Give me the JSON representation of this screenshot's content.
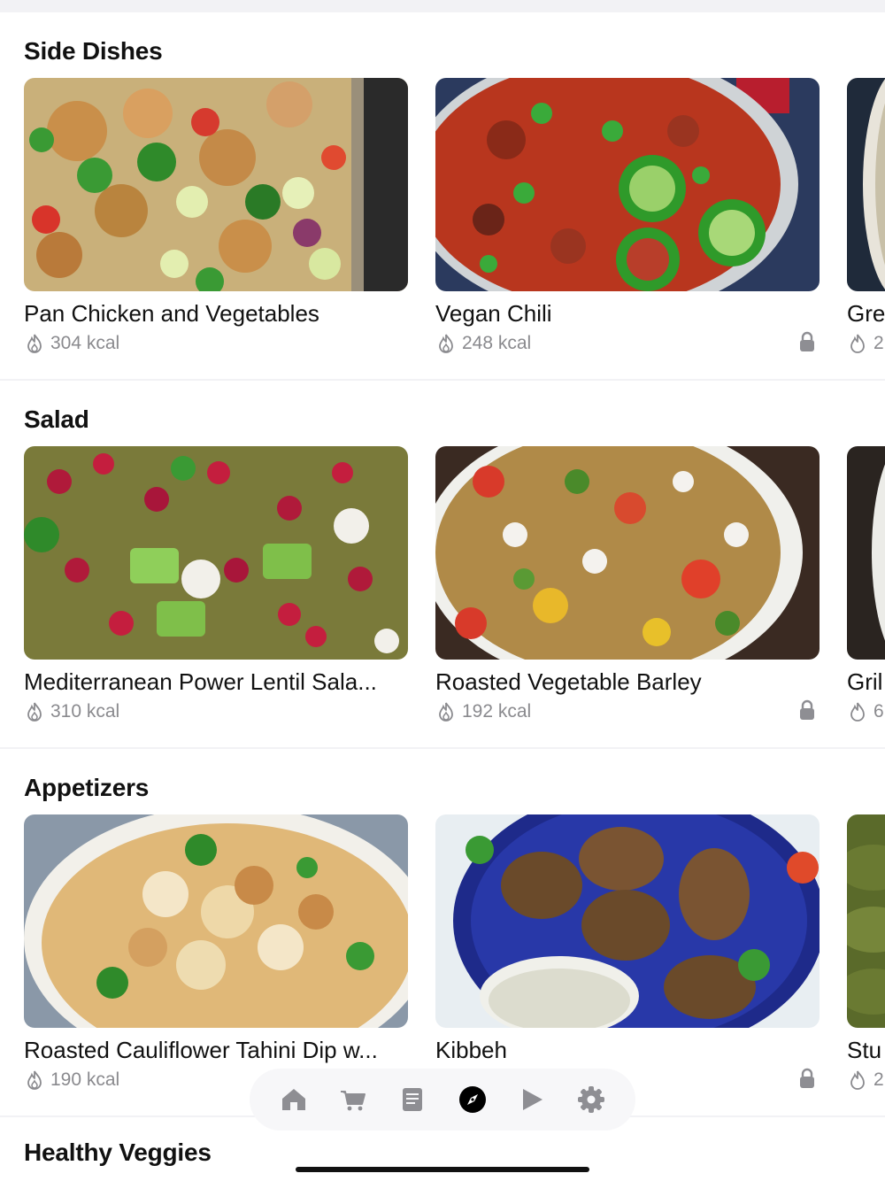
{
  "sections": [
    {
      "title": "Side Dishes",
      "cards": [
        {
          "name": "Pan Chicken and Vegetables",
          "kcal": "304 kcal",
          "locked": false
        },
        {
          "name": "Vegan Chili",
          "kcal": "248 kcal",
          "locked": true
        },
        {
          "name": "Gre",
          "kcal": "2",
          "locked": false
        }
      ]
    },
    {
      "title": "Salad",
      "cards": [
        {
          "name": "Mediterranean Power Lentil Sala...",
          "kcal": "310 kcal",
          "locked": false
        },
        {
          "name": "Roasted Vegetable Barley",
          "kcal": "192 kcal",
          "locked": true
        },
        {
          "name": "Gril",
          "kcal": "6",
          "locked": false
        }
      ]
    },
    {
      "title": "Appetizers",
      "cards": [
        {
          "name": "Roasted Cauliflower Tahini Dip w...",
          "kcal": "190 kcal",
          "locked": false
        },
        {
          "name": "Kibbeh",
          "kcal": "",
          "locked": true
        },
        {
          "name": "Stu",
          "kcal": "2",
          "locked": false
        }
      ]
    },
    {
      "title": "Healthy Veggies",
      "cards": []
    }
  ],
  "tabbar": {
    "items": [
      {
        "icon": "home-icon",
        "active": false
      },
      {
        "icon": "cart-icon",
        "active": false
      },
      {
        "icon": "book-icon",
        "active": false
      },
      {
        "icon": "compass-icon",
        "active": true
      },
      {
        "icon": "play-icon",
        "active": false
      },
      {
        "icon": "gear-icon",
        "active": false
      }
    ]
  },
  "colors": {
    "background": "#f2f2f5",
    "card_bg": "#ffffff",
    "text": "#111111",
    "muted": "#8a8a8e",
    "tab_icon": "#8e8e93",
    "tab_active": "#000000"
  }
}
